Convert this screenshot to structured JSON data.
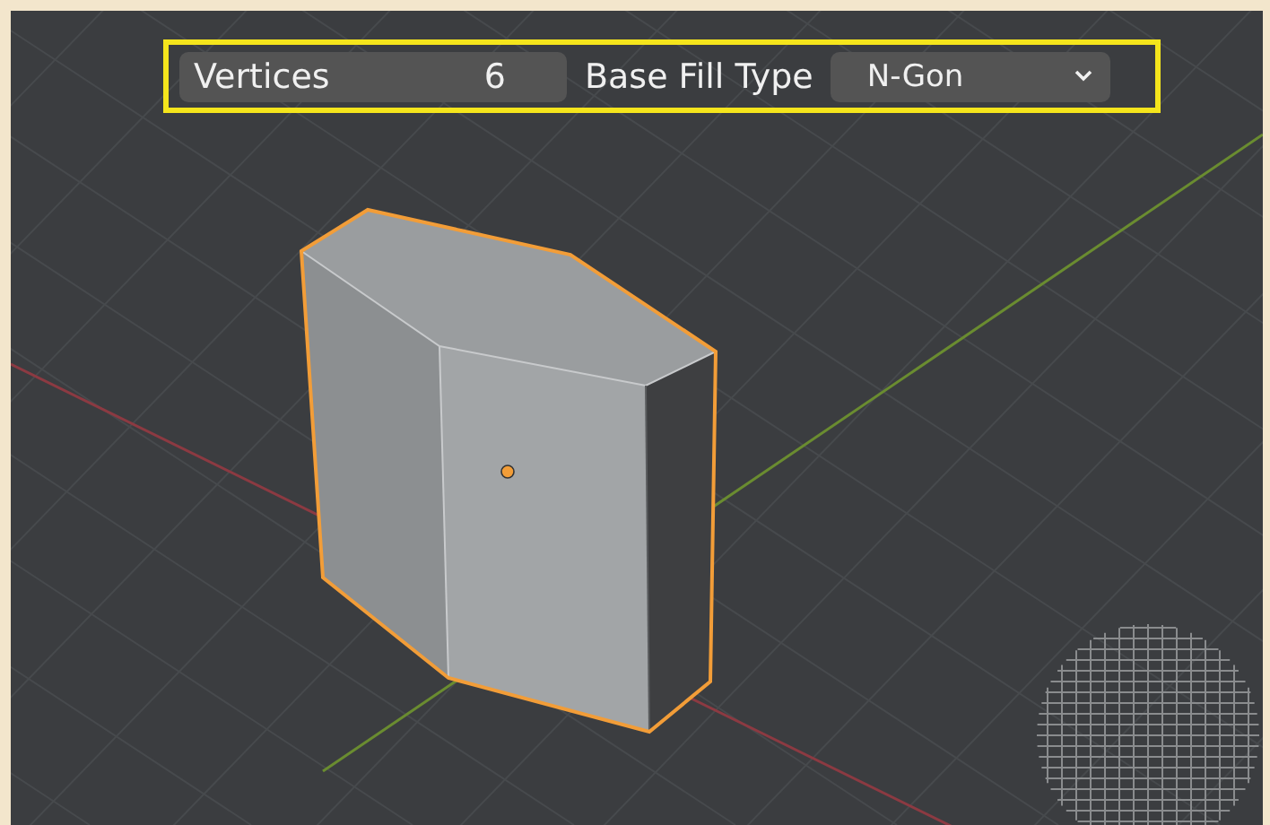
{
  "toolbar": {
    "highlighted": true,
    "fields": [
      {
        "kind": "number",
        "label": "Vertices",
        "value": "6"
      },
      {
        "kind": "dropdown",
        "label": "Base Fill Type",
        "value": "N-Gon"
      }
    ]
  }
}
